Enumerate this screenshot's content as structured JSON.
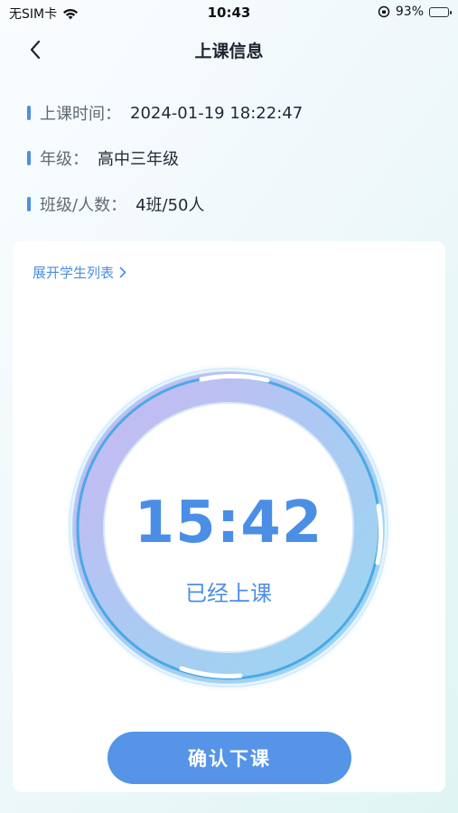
{
  "status_bar": {
    "carrier": "无SIM卡",
    "time": "10:43",
    "battery": "93%",
    "battery_level": 0.93
  },
  "nav": {
    "title": "上课信息",
    "back_icon": "chevron-left-icon"
  },
  "info": [
    {
      "label": "上课时间：",
      "value": "2024-01-19 18:22:47"
    },
    {
      "label": "年级：",
      "value": "高中三年级"
    },
    {
      "label": "班级/人数：",
      "value": "4班/50人"
    }
  ],
  "card": {
    "expand_link": "展开学生列表",
    "timer": "15:42",
    "status": "已经上课",
    "confirm_button": "确认下课"
  },
  "colors": {
    "accent": "#4a90e2",
    "button": "#5594e6",
    "timer_text": "#4b8ee6"
  }
}
